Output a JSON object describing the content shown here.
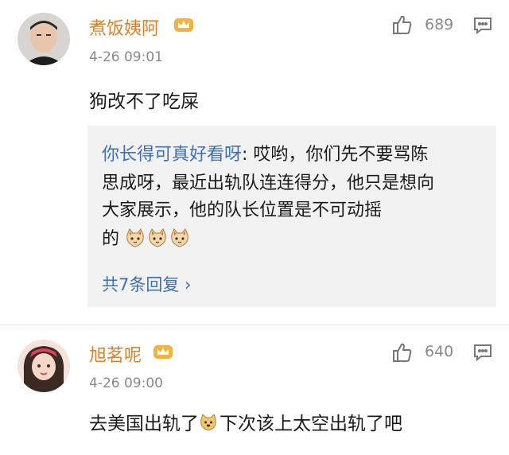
{
  "comments": [
    {
      "username": "煮饭姨阿",
      "timestamp": "4-26 09:01",
      "like_count": "689",
      "body": "狗改不了吃屎",
      "reply": {
        "author": "你长得可真好看呀",
        "text_line1": ": 哎哟，你们先不要骂陈",
        "text_line2": "思成呀，最近出轨队连连得分，他只是想向",
        "text_line3": "大家展示，他的队长位置是不可动摇",
        "text_line4": "的",
        "more_label": "共7条回复 ›"
      }
    },
    {
      "username": "旭茗呢",
      "timestamp": "4-26 09:00",
      "like_count": "640",
      "body_part1": "去美国出轨了",
      "body_part2": "下次该上太空出轨了吧"
    }
  ],
  "colors": {
    "username": "#d9822b",
    "reply_author": "#3f6fb5",
    "meta": "#8a8a8a",
    "reply_bg": "#f2f2f2"
  },
  "icons": {
    "crown": "crown-badge-icon",
    "like": "thumbs-up-icon",
    "reply": "comment-bubble-icon",
    "emoji_cat": "cat-face-emoji",
    "emoji_doge": "doge-emoji"
  }
}
